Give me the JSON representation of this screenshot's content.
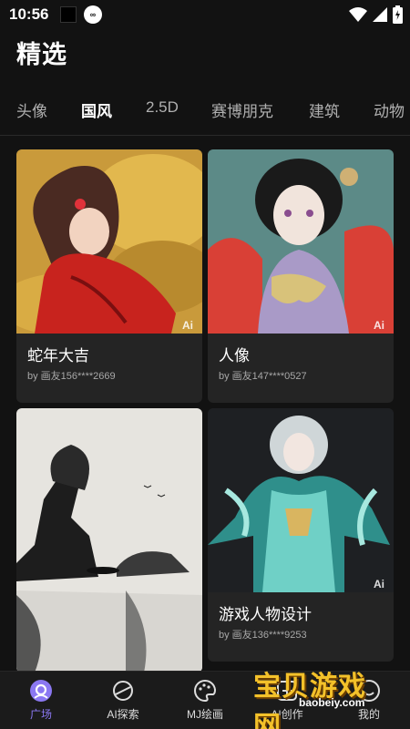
{
  "status_bar": {
    "time": "10:56",
    "icons": [
      "notification-square-icon",
      "app-badge-icon",
      "wifi-icon",
      "signal-icon",
      "battery-icon"
    ]
  },
  "page": {
    "title": "精选"
  },
  "tabs": [
    {
      "label": "头像",
      "active": false
    },
    {
      "label": "国风",
      "active": true
    },
    {
      "label": "2.5D",
      "active": false
    },
    {
      "label": "赛博朋克",
      "active": false
    },
    {
      "label": "建筑",
      "active": false
    },
    {
      "label": "动物",
      "active": false
    }
  ],
  "cards": [
    {
      "title": "蛇年大吉",
      "author": "by 画友156****2669",
      "ai_mark": "Ai"
    },
    {
      "title": "人像",
      "author": "by 画友147****0527",
      "ai_mark": "Ai"
    },
    {
      "title": "",
      "author": "",
      "ai_mark": ""
    },
    {
      "title": "游戏人物设计",
      "author": "by 画友136****9253",
      "ai_mark": "Ai"
    }
  ],
  "bottom_nav": [
    {
      "label": "广场",
      "icon": "plaza-icon",
      "active": true
    },
    {
      "label": "AI探索",
      "icon": "explore-icon",
      "active": false
    },
    {
      "label": "MJ绘画",
      "icon": "palette-icon",
      "active": false
    },
    {
      "label": "AI创作",
      "icon": "create-icon",
      "active": false
    },
    {
      "label": "我的",
      "icon": "profile-icon",
      "active": false
    }
  ],
  "watermark": {
    "text": "宝贝游戏网",
    "url": "baobeiy.com"
  },
  "colors": {
    "background": "#121212",
    "card": "#242424",
    "accent": "#8b78f2"
  }
}
